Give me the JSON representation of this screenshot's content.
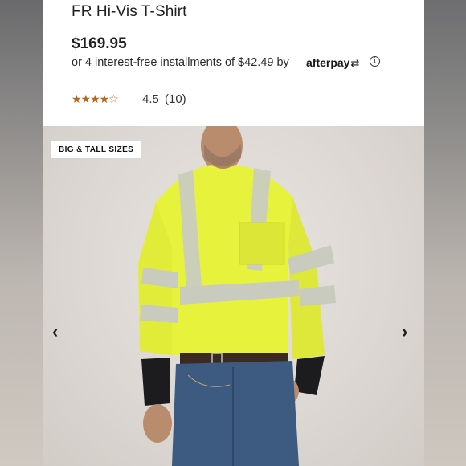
{
  "product": {
    "title": "FR Hi-Vis T-Shirt",
    "price": "$169.95",
    "installments_text": "or 4 interest-free installments of $42.49 by",
    "afterpay_brand": "afterpay",
    "info_icon": "info-icon",
    "stars": "★★★★☆",
    "rating": "4.5",
    "review_count": "(10)"
  },
  "gallery": {
    "badge": "BIG & TALL SIZES",
    "prev_icon": "chevron-left-icon",
    "next_icon": "chevron-right-icon",
    "prev_glyph": "‹",
    "next_glyph": "›"
  },
  "colors": {
    "star": "#b5681d",
    "shirt": "#e6f23c",
    "reflective": "#c9ccc0"
  }
}
